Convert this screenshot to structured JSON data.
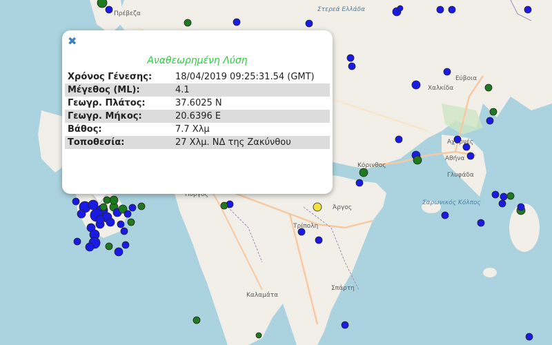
{
  "map": {
    "places": [
      {
        "name": "Πρέβεζα",
        "italic": false
      },
      {
        "name": "Στερεά Ελλάδα",
        "italic": true
      },
      {
        "name": "Εύβοια",
        "italic": false
      },
      {
        "name": "Χαλκίδα",
        "italic": false
      },
      {
        "name": "Αχαρνές",
        "italic": false
      },
      {
        "name": "Αθήνα",
        "italic": false
      },
      {
        "name": "Γλυφάδα",
        "italic": false
      },
      {
        "name": "Κόρινθος",
        "italic": false
      },
      {
        "name": "Σαρωνικός Κόλπος",
        "italic": true
      },
      {
        "name": "Πύργος",
        "italic": false
      },
      {
        "name": "Άργος",
        "italic": false
      },
      {
        "name": "Τρίπολη",
        "italic": false
      },
      {
        "name": "Σπάρτη",
        "italic": false
      },
      {
        "name": "Καλαμάτα",
        "italic": false
      }
    ],
    "colors": {
      "sea": "#aad3df",
      "land": "#f2efe9",
      "road": "#f7c9a1",
      "blue_marker": "#1a1ae6",
      "green_marker": "#1f7a1f",
      "yellow_marker": "#f0e040"
    }
  },
  "popup": {
    "close_icon": "close-icon",
    "title": "Αναθεωρημένη Λύση",
    "rows": [
      {
        "label": "Χρόνος Γένεσης:",
        "value": "18/04/2019 09:25:31.54 (GMT)"
      },
      {
        "label": "Μέγεθος (ML):",
        "value": "4.1"
      },
      {
        "label": "Γεωγρ. Πλάτος:",
        "value": "37.6025 N"
      },
      {
        "label": "Γεωγρ. Μήκος:",
        "value": "20.6396 E"
      },
      {
        "label": "Βάθος:",
        "value": "7.7 Χλμ"
      },
      {
        "label": "Τοποθεσία:",
        "value": "27 Χλμ. ΝΔ της Ζακύνθου"
      }
    ]
  }
}
